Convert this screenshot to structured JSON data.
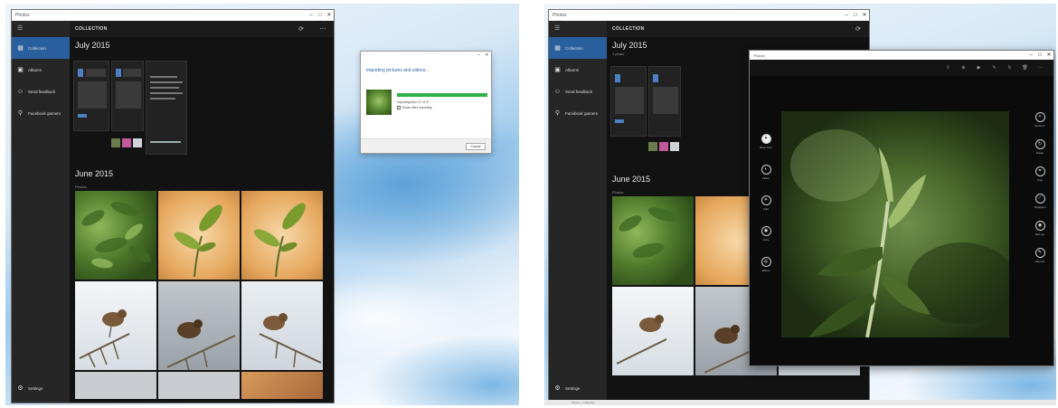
{
  "left": {
    "window_title": "Photos",
    "window_controls": [
      "–",
      "□",
      "✕"
    ],
    "header": {
      "title": "COLLECTION",
      "icons": [
        "refresh-icon",
        "more-icon"
      ]
    },
    "sidebar": {
      "items": [
        {
          "label": "Collection",
          "icon": "collection-icon",
          "active": true
        },
        {
          "label": "Albums",
          "icon": "albums-icon",
          "active": false
        },
        {
          "label": "Send feedback",
          "icon": "feedback-icon",
          "active": false
        },
        {
          "label": "Facebook gamers",
          "icon": "pin-icon",
          "active": false
        }
      ],
      "settings_label": "Settings"
    },
    "sections": [
      {
        "month": "July 2015"
      },
      {
        "month": "June 2015",
        "subtitle": "Photos"
      }
    ],
    "dialog": {
      "heading": "Importing pictures and videos...",
      "status": "Importing item 37 of 37",
      "checkbox_label": "Erase after importing",
      "cancel_label": "Cancel",
      "progress": 1.0,
      "progress_color": "#2fb04a"
    }
  },
  "right": {
    "window_title": "Photos",
    "header": {
      "title": "COLLECTION"
    },
    "sidebar": {
      "items": [
        {
          "label": "Collection",
          "icon": "collection-icon",
          "active": true
        },
        {
          "label": "Albums",
          "icon": "albums-icon",
          "active": false
        },
        {
          "label": "Send feedback",
          "icon": "feedback-icon",
          "active": false
        },
        {
          "label": "Facebook gamers",
          "icon": "pin-icon",
          "active": false
        }
      ],
      "settings_label": "Settings"
    },
    "sections": [
      {
        "month": "July 2015",
        "subtitle": "1 photo"
      },
      {
        "month": "June 2015",
        "subtitle": "Photos"
      }
    ],
    "viewer": {
      "window_title": "Photos",
      "toolbar_icons": [
        "share-icon",
        "zoom-icon",
        "slideshow-icon",
        "edit-icon",
        "rotate-icon",
        "delete-icon",
        "more-icon"
      ],
      "left_tools": [
        {
          "label": "Basic fixes",
          "icon": "wand-icon"
        },
        {
          "label": "Filters",
          "icon": "filter-icon"
        },
        {
          "label": "Light",
          "icon": "light-icon"
        },
        {
          "label": "Color",
          "icon": "color-icon"
        },
        {
          "label": "Effects",
          "icon": "effects-icon"
        }
      ],
      "right_tools": [
        {
          "label": "Enhance",
          "icon": "enhance-icon"
        },
        {
          "label": "Rotate",
          "icon": "rotate-icon"
        },
        {
          "label": "Crop",
          "icon": "crop-icon"
        },
        {
          "label": "Straighten",
          "icon": "straighten-icon"
        },
        {
          "label": "Red eye",
          "icon": "redeye-icon"
        },
        {
          "label": "Retouch",
          "icon": "retouch-icon"
        }
      ]
    },
    "taskbar_text": "Photos – Collection"
  },
  "colors": {
    "accent": "#2a5f9e",
    "sidebar_bg": "#262626",
    "content_bg": "#121212"
  }
}
